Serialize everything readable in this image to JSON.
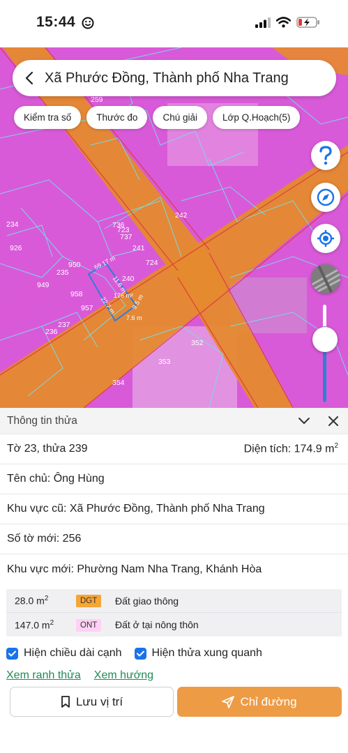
{
  "status_bar": {
    "time": "15:44"
  },
  "map": {
    "search_title": "Xã Phước Đồng, Thành phố Nha Trang",
    "chips": [
      "Kiểm tra số",
      "Thước đo",
      "Chú giải",
      "Lớp Q.Hoạch(5)"
    ],
    "parcel_labels": [
      "259",
      "234",
      "926",
      "736",
      "723",
      "737",
      "242",
      "241",
      "724",
      "950",
      "235",
      "240",
      "949",
      "958",
      "176 m²",
      "957",
      "237",
      "236",
      "352",
      "353",
      "354"
    ],
    "edge_labels": [
      "59.17 m",
      "11.6 m",
      "22.7 m",
      "9.5 m",
      "7.6 m"
    ],
    "zoom_level": 0.78
  },
  "panel": {
    "title": "Thông tin thửa",
    "sheet_plot": "Tờ 23, thửa 239",
    "area_label": "Diện tích: 174.9 m",
    "area_sup": "2",
    "owner": "Tên chủ: Ông Hùng",
    "old_region": "Khu vực cũ: Xã Phước Đồng, Thành phố Nha Trang",
    "new_sheet": "Số tờ mới: 256",
    "new_region": "Khu vực mới: Phường Nam Nha Trang, Khánh Hòa",
    "land_uses": [
      {
        "area": "28.0 m",
        "sup": "2",
        "code": "DGT",
        "name": "Đất giao thông",
        "color": "#f6a637"
      },
      {
        "area": "147.0 m",
        "sup": "2",
        "code": "ONT",
        "name": "Đất ở tại nông thôn",
        "color": "#ffd1f4"
      }
    ],
    "checkboxes": [
      "Hiện chiều dài cạnh",
      "Hiện thửa xung quanh"
    ],
    "links": [
      "Xem ranh thửa",
      "Xem hướng"
    ],
    "save_label": "Lưu vị trí",
    "route_label": "Chỉ đường"
  },
  "colors": {
    "accent": "#ee9b45",
    "link": "#1f8a55",
    "checkbox": "#1a73e8",
    "zone_pink": "#d95ad8",
    "road_orange": "#e58a2e"
  }
}
